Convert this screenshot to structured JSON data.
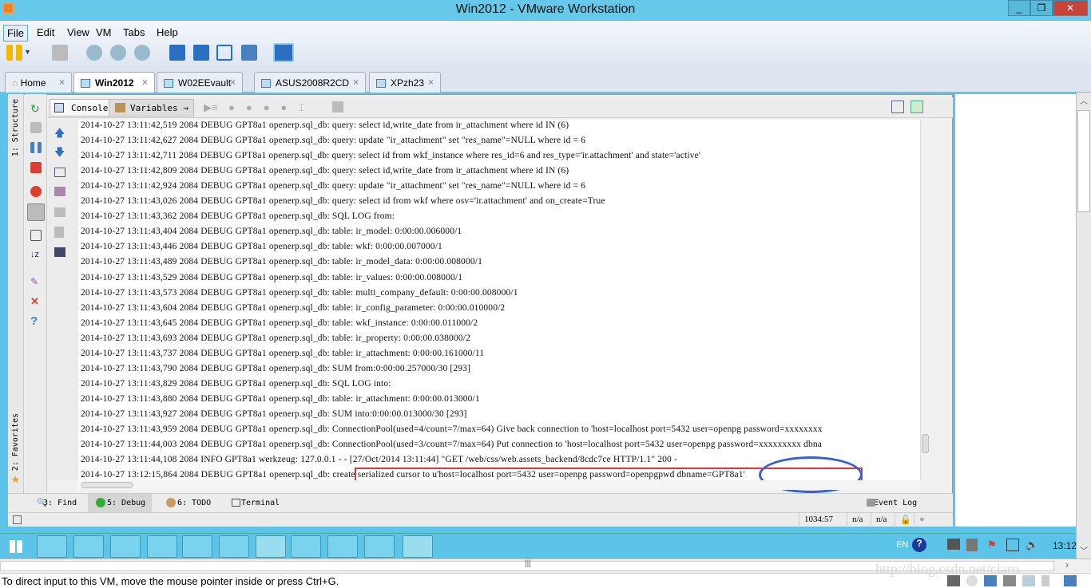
{
  "window": {
    "title": "Win2012 - VMware Workstation",
    "controls": [
      "_",
      "❐",
      "✕"
    ]
  },
  "menu": [
    "File",
    "Edit",
    "View",
    "VM",
    "Tabs",
    "Help"
  ],
  "tabs": [
    {
      "label": "Home"
    },
    {
      "label": "Win2012"
    },
    {
      "label": "W02EEvault"
    },
    {
      "label": "ASUS2008R2CD"
    },
    {
      "label": "XPzh23"
    }
  ],
  "ide": {
    "side_labels": [
      "1: Structure",
      "2: Favorites"
    ],
    "console_tabs": [
      "Console",
      "Variables"
    ],
    "log_lines": [
      "2014-10-27 13:11:42,519 2084 DEBUG GPT8a1 openerp.sql_db: query: select id,write_date from ir_attachment where id IN (6)",
      "2014-10-27 13:11:42,627 2084 DEBUG GPT8a1 openerp.sql_db: query: update \"ir_attachment\" set \"res_name\"=NULL where id = 6",
      "2014-10-27 13:11:42,711 2084 DEBUG GPT8a1 openerp.sql_db: query: select id from wkf_instance where res_id=6 and res_type='ir.attachment' and state='active'",
      "2014-10-27 13:11:42,809 2084 DEBUG GPT8a1 openerp.sql_db: query: select id,write_date from ir_attachment where id IN (6)",
      "2014-10-27 13:11:42,924 2084 DEBUG GPT8a1 openerp.sql_db: query: update \"ir_attachment\" set \"res_name\"=NULL where id = 6",
      "2014-10-27 13:11:43,026 2084 DEBUG GPT8a1 openerp.sql_db: query: select id from wkf where osv='ir.attachment' and on_create=True",
      "2014-10-27 13:11:43,362 2084 DEBUG GPT8a1 openerp.sql_db: SQL LOG from:",
      "2014-10-27 13:11:43,404 2084 DEBUG GPT8a1 openerp.sql_db: table: ir_model: 0:00:00.006000/1",
      "2014-10-27 13:11:43,446 2084 DEBUG GPT8a1 openerp.sql_db: table: wkf: 0:00:00.007000/1",
      "2014-10-27 13:11:43,489 2084 DEBUG GPT8a1 openerp.sql_db: table: ir_model_data: 0:00:00.008000/1",
      "2014-10-27 13:11:43,529 2084 DEBUG GPT8a1 openerp.sql_db: table: ir_values: 0:00:00.008000/1",
      "2014-10-27 13:11:43,573 2084 DEBUG GPT8a1 openerp.sql_db: table: multi_company_default: 0:00:00.008000/1",
      "2014-10-27 13:11:43,604 2084 DEBUG GPT8a1 openerp.sql_db: table: ir_config_parameter: 0:00:00.010000/2",
      "2014-10-27 13:11:43,645 2084 DEBUG GPT8a1 openerp.sql_db: table: wkf_instance: 0:00:00.011000/2",
      "2014-10-27 13:11:43,693 2084 DEBUG GPT8a1 openerp.sql_db: table: ir_property: 0:00:00.038000/2",
      "2014-10-27 13:11:43,737 2084 DEBUG GPT8a1 openerp.sql_db: table: ir_attachment: 0:00:00.161000/11",
      "2014-10-27 13:11:43,790 2084 DEBUG GPT8a1 openerp.sql_db: SUM from:0:00:00.257000/30 [293]",
      "2014-10-27 13:11:43,829 2084 DEBUG GPT8a1 openerp.sql_db: SQL LOG into:",
      "2014-10-27 13:11:43,880 2084 DEBUG GPT8a1 openerp.sql_db: table: ir_attachment: 0:00:00.013000/1",
      "2014-10-27 13:11:43,927 2084 DEBUG GPT8a1 openerp.sql_db: SUM into:0:00:00.013000/30 [293]",
      "2014-10-27 13:11:43,959 2084 DEBUG GPT8a1 openerp.sql_db: ConnectionPool(used=4/count=7/max=64) Give back connection to 'host=localhost port=5432 user=openpg password=xxxxxxxx",
      "2014-10-27 13:11:44,003 2084 DEBUG GPT8a1 openerp.sql_db: ConnectionPool(used=3/count=7/max=64) Put connection to 'host=localhost port=5432 user=openpg password=xxxxxxxxx dbna",
      "2014-10-27 13:11:44,108 2084 INFO GPT8a1 werkzeug: 127.0.0.1 - - [27/Oct/2014 13:11:44] \"GET /web/css/web.assets_backend/8cdc7ce HTTP/1.1\" 200 -",
      "2014-10-27 13:12:15,864 2084 DEBUG GPT8a1 openerp.sql_db: create serialized cursor to u'host=localhost port=5432 user=openpg password=openpgpwd dbname=GPT8a1'"
    ],
    "tool_windows": [
      "3: Find",
      "5: Debug",
      "6: TODO",
      "Terminal"
    ],
    "event_log": "Event Log",
    "status": {
      "position": "1034:57",
      "encoding": "n/a",
      "line_sep": "n/a"
    }
  },
  "taskbar": {
    "lang": "EN",
    "clock": "13:12"
  },
  "host_status": "To direct input to this VM, move the mouse pointer inside or press Ctrl+G.",
  "watermark": "http://blog.csdn.net/claro"
}
